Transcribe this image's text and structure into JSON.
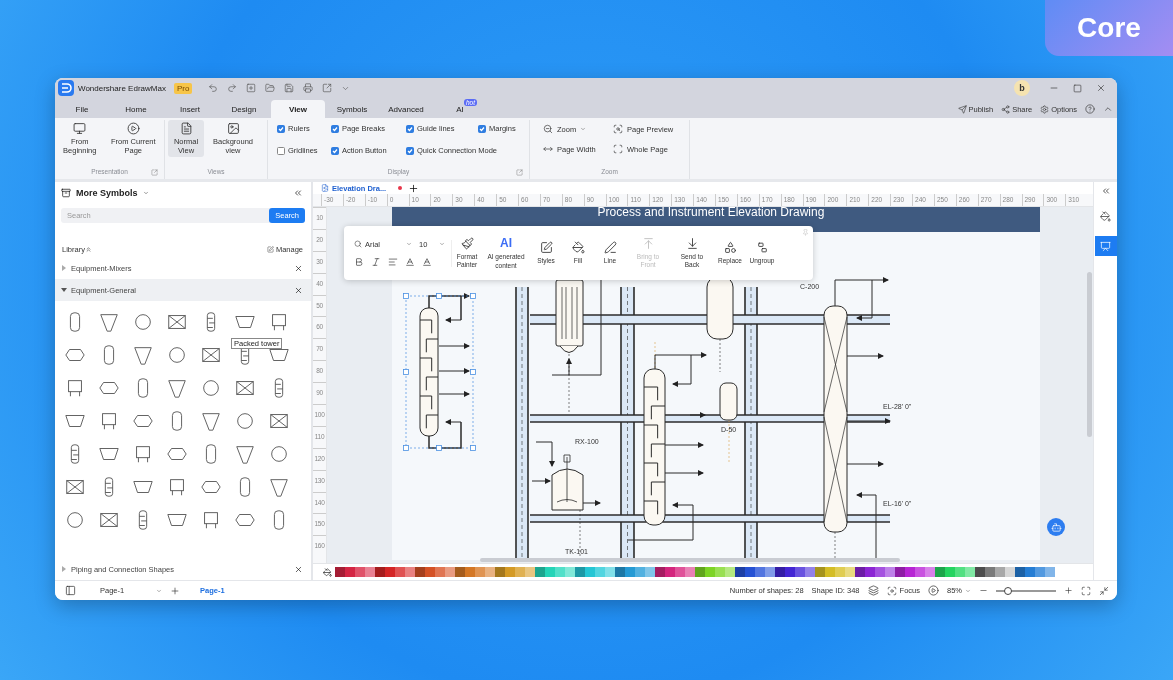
{
  "window": {
    "app_name": "Wondershare EdrawMax",
    "edition": "Pro",
    "user_initial": "b"
  },
  "promo_badge": "Core",
  "menu_tabs": [
    {
      "label": "File",
      "selected": false
    },
    {
      "label": "Home",
      "selected": false
    },
    {
      "label": "Insert",
      "selected": false
    },
    {
      "label": "Design",
      "selected": false
    },
    {
      "label": "View",
      "selected": true
    },
    {
      "label": "Symbols",
      "selected": false
    },
    {
      "label": "Advanced",
      "selected": false
    },
    {
      "label": "AI",
      "selected": false,
      "badge": "hot"
    }
  ],
  "menu_actions": [
    {
      "kind": "publish",
      "label": "Publish"
    },
    {
      "kind": "share",
      "label": "Share"
    },
    {
      "kind": "options",
      "label": "Options"
    }
  ],
  "ribbon": {
    "presentation": {
      "title": "Presentation",
      "buttons": [
        {
          "kind": "beginning",
          "label": "From Beginning"
        },
        {
          "kind": "current",
          "label": "From Current Page"
        }
      ]
    },
    "views": {
      "title": "Views",
      "buttons": [
        {
          "kind": "normal",
          "label": "Normal View",
          "selected": true
        },
        {
          "kind": "background",
          "label": "Background view",
          "selected": false
        }
      ]
    },
    "display": {
      "title": "Display",
      "options": [
        {
          "label": "Rulers",
          "checked": true
        },
        {
          "label": "Page Breaks",
          "checked": true
        },
        {
          "label": "Guide lines",
          "checked": true
        },
        {
          "label": "Margins",
          "checked": true
        },
        {
          "label": "Gridlines",
          "checked": false
        },
        {
          "label": "Action Button",
          "checked": true
        },
        {
          "label": "Quick Connection Mode",
          "checked": true
        }
      ]
    },
    "zoom": {
      "title": "Zoom",
      "buttons": [
        {
          "kind": "zoom",
          "label": "Zoom"
        },
        {
          "kind": "preview",
          "label": "Page Preview"
        },
        {
          "kind": "width",
          "label": "Page Width"
        },
        {
          "kind": "whole",
          "label": "Whole Page"
        }
      ]
    }
  },
  "symbols_panel": {
    "title": "More Symbols",
    "search": {
      "placeholder": "Search",
      "button": "Search"
    },
    "library_label": "Library",
    "manage": "Manage",
    "libraries": [
      {
        "name": "Equipment-Mixers",
        "expanded": false
      },
      {
        "name": "Equipment-General",
        "expanded": true,
        "tooltip": "Packed tower"
      },
      {
        "name": "Piping and Connection Shapes",
        "expanded": false
      }
    ]
  },
  "document_tab": {
    "title": "Elevation Dra...",
    "modified": true
  },
  "ruler": {
    "horizontal": [
      "-30",
      "-20",
      "-10",
      "0",
      "10",
      "20",
      "30",
      "40",
      "50",
      "60",
      "70",
      "80",
      "90",
      "100",
      "110",
      "120",
      "130",
      "140",
      "150",
      "160",
      "170",
      "180",
      "190",
      "200",
      "210",
      "220",
      "230",
      "240",
      "250",
      "260",
      "270",
      "280",
      "290",
      "300",
      "310"
    ],
    "vertical": [
      "10",
      "20",
      "30",
      "40",
      "50",
      "60",
      "70",
      "80",
      "90",
      "100",
      "110",
      "120",
      "130",
      "140",
      "150",
      "160"
    ]
  },
  "drawing": {
    "title": "Process and Instrument Elevation Drawing",
    "labels": [
      {
        "text": "C-200"
      },
      {
        "text": "RX-100"
      },
      {
        "text": "D-50"
      },
      {
        "text": "EL-28' 0\""
      },
      {
        "text": "EL-16' 0\""
      },
      {
        "text": "TK-101"
      }
    ]
  },
  "floating_toolbar": {
    "font": "Arial",
    "size": "10",
    "tools": [
      {
        "kind": "painter",
        "label": "Format Painter",
        "disabled": false
      },
      {
        "kind": "ai",
        "icon_text": "AI",
        "label": "AI generated content",
        "disabled": false
      },
      {
        "kind": "styles",
        "label": "Styles",
        "disabled": false
      },
      {
        "kind": "fill",
        "label": "Fill",
        "disabled": false
      },
      {
        "kind": "line",
        "label": "Line",
        "disabled": false
      },
      {
        "kind": "front",
        "label": "Bring to Front",
        "disabled": true
      },
      {
        "kind": "back",
        "label": "Send to Back",
        "disabled": false
      },
      {
        "kind": "replace",
        "label": "Replace",
        "disabled": false
      },
      {
        "kind": "ungroup",
        "label": "Ungroup",
        "disabled": false
      }
    ]
  },
  "right_panel": {
    "tools": [
      {
        "kind": "fill",
        "selected": false
      },
      {
        "kind": "present",
        "selected": true
      }
    ]
  },
  "status_bar": {
    "page_select": "Page-1",
    "pages": [
      {
        "label": "Page-1",
        "selected": true
      }
    ],
    "shape_count": "Number of shapes: 28",
    "shape_id": "Shape ID: 348",
    "focus": "Focus",
    "zoom": "85%",
    "zoom_slider": {
      "level": 0.2
    }
  }
}
